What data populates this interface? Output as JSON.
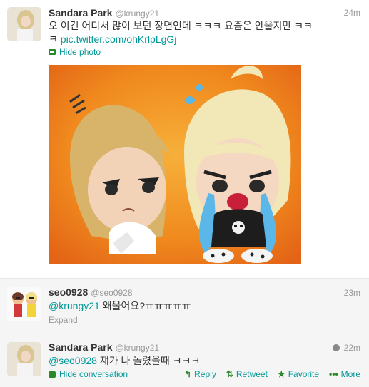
{
  "tweets": [
    {
      "fullname": "Sandara Park",
      "username": "@krungy21",
      "time": "24m",
      "text_line1": "오 이건 어디서 많이 보던 장면인데 ㅋㅋㅋ 요즘은 안울지만 ㅋㅋ",
      "text_line2_prefix": "ㅋ",
      "text_link": "pic.twitter.com/ohKrlpLgGj",
      "hide_photo": "Hide photo"
    },
    {
      "fullname": "seo0928",
      "username": "@seo0928",
      "time": "23m",
      "mention": "@krungy21",
      "text_rest": " 왜울어요?ㅠㅠㅠㅠㅠ",
      "expand": "Expand"
    },
    {
      "fullname": "Sandara Park",
      "username": "@krungy21",
      "time": "22m",
      "mention": "@seo0928",
      "text_rest": " 쟤가 나 놀렸을때 ㅋㅋㅋ",
      "hide_conversation": "Hide conversation",
      "actions": {
        "reply": "Reply",
        "retweet": "Retweet",
        "favorite": "Favorite",
        "more": "More"
      }
    }
  ],
  "colors": {
    "link": "#009999",
    "muted": "#999999",
    "icon_green": "#2a8a2a"
  }
}
